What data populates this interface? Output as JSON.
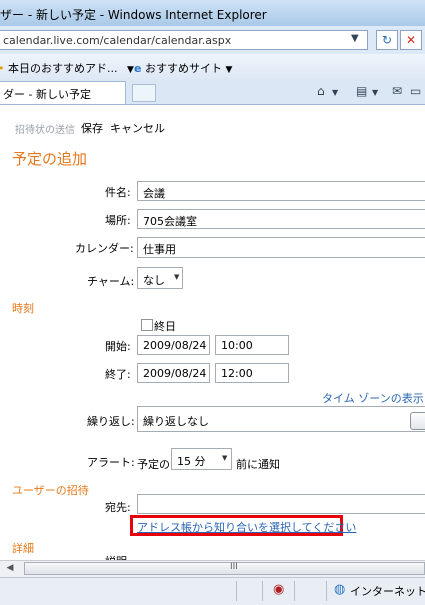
{
  "window": {
    "title": "ザー - 新しい予定 - Windows Internet Explorer"
  },
  "address_bar": {
    "url": "calendar.live.com/calendar/calendar.aspx",
    "refresh_icon": "refresh-icon",
    "stop_icon": "stop-icon"
  },
  "favorites_bar": {
    "items": [
      {
        "label": "本日のおすすめアド...",
        "suffix": "▼"
      },
      {
        "label": "おすすめサイト",
        "suffix": "▼"
      }
    ]
  },
  "tabs": {
    "active_label": "ダー - 新しい予定"
  },
  "toolbar": {
    "send_invite": "招待状の送信",
    "save": "保存",
    "cancel": "キャンセル"
  },
  "form": {
    "heading": "予定の追加",
    "subject_label": "件名:",
    "subject_value": "会議",
    "location_label": "場所:",
    "location_value": "705会議室",
    "calendar_label": "カレンダー:",
    "calendar_value": "仕事用",
    "charm_label": "チャーム:",
    "charm_value": "なし",
    "time_section": "時刻",
    "all_day_label": "終日",
    "start_label": "開始:",
    "start_date": "2009/08/24",
    "start_time": "10:00",
    "end_label": "終了:",
    "end_date": "2009/08/24",
    "end_time": "12:00",
    "timezone_link": "タイム ゾーンの表示",
    "repeat_label": "繰り返し:",
    "repeat_value": "繰り返しなし",
    "alert_label": "アラート:",
    "alert_prefix": "予定の",
    "alert_value": "15 分",
    "alert_suffix": "前に通知",
    "invite_section": "ユーザーの招待",
    "to_label": "宛先:",
    "address_book_link": "アドレス帳から知り合いを選択してください",
    "details_section": "詳細",
    "details_label_partial": "説明"
  },
  "statusbar": {
    "zone_text": "インターネット",
    "scroll_grip": "III"
  },
  "colors": {
    "accent_orange": "#e5781b",
    "link_blue": "#2a66b5",
    "highlight_red": "#e8000b"
  }
}
